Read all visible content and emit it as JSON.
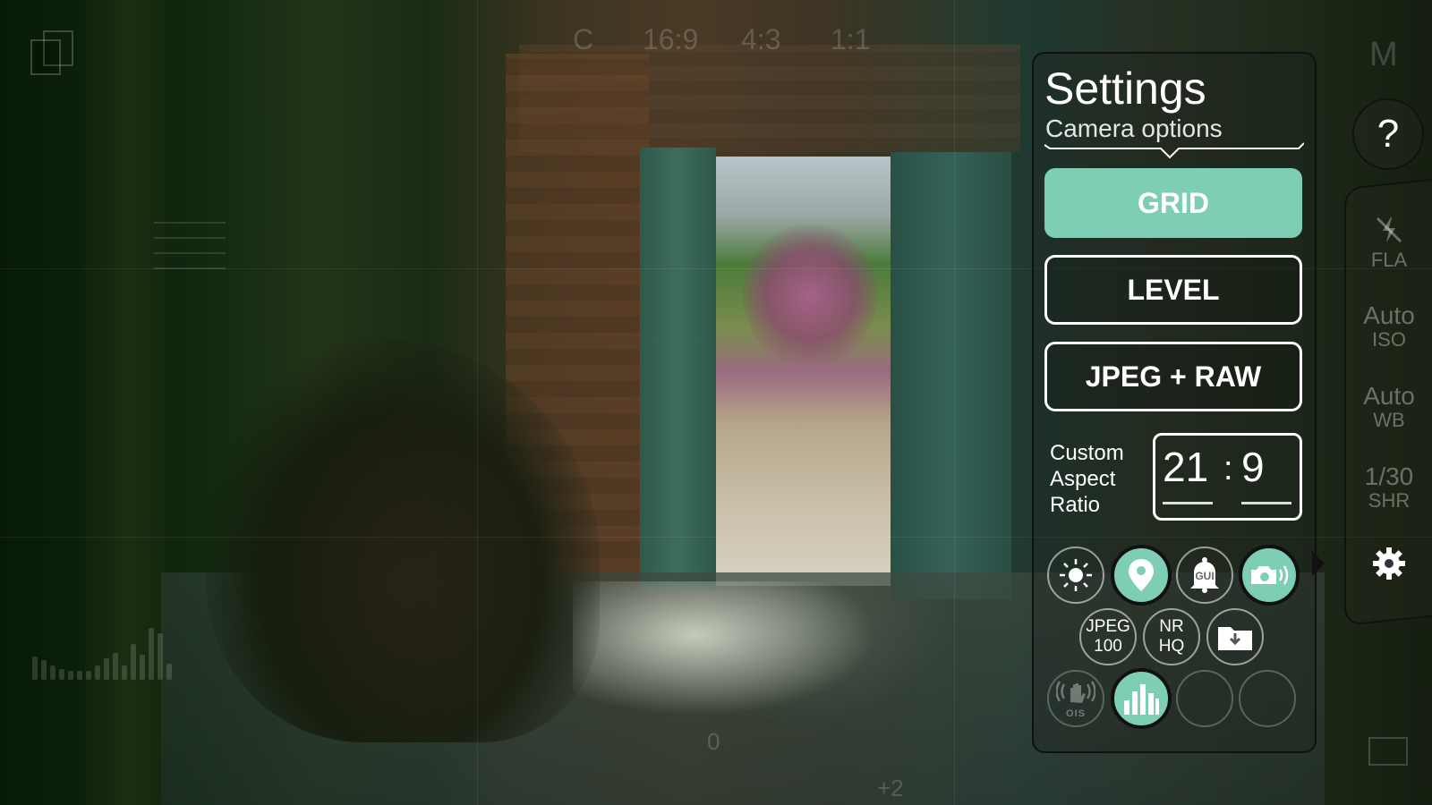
{
  "viewfinder": {
    "aspect_ratios": [
      "C",
      "16:9",
      "4:3",
      "1:1"
    ],
    "mode_label": "M",
    "exposure_marks": [
      "0",
      "+2"
    ]
  },
  "settings_panel": {
    "title": "Settings",
    "subtitle": "Camera options",
    "toggles": [
      {
        "label": "GRID",
        "active": true
      },
      {
        "label": "LEVEL",
        "active": false
      },
      {
        "label": "JPEG + RAW",
        "active": false
      }
    ],
    "custom_aspect_ratio": {
      "label_lines": [
        "Custom",
        "Aspect",
        "Ratio"
      ],
      "width": "21",
      "separator": ":",
      "height": "9"
    },
    "icon_buttons_row1": [
      {
        "name": "brightness",
        "icon": "sun-icon",
        "active": false
      },
      {
        "name": "location",
        "icon": "location-pin-icon",
        "active": true
      },
      {
        "name": "gui-sound",
        "icon": "bell-gui-icon",
        "label": "GUI",
        "active": false
      },
      {
        "name": "shutter-sound",
        "icon": "camera-sound-icon",
        "active": true
      }
    ],
    "icon_buttons_row2": [
      {
        "name": "jpeg-quality",
        "line1": "JPEG",
        "line2": "100",
        "active": false
      },
      {
        "name": "noise-reduction",
        "line1": "NR",
        "line2": "HQ",
        "active": false
      },
      {
        "name": "save-location",
        "icon": "folder-download-icon",
        "active": false
      }
    ],
    "icon_buttons_row3": [
      {
        "name": "ois",
        "icon": "hand-stabilize-icon",
        "label": "OIS",
        "active": false,
        "disabled": true
      },
      {
        "name": "histogram",
        "icon": "histogram-icon",
        "active": true
      },
      {
        "name": "empty-slot-1",
        "active": false,
        "disabled": true
      },
      {
        "name": "empty-slot-2",
        "active": false,
        "disabled": true
      }
    ]
  },
  "right_rail": {
    "help_label": "?",
    "items": [
      {
        "value": "",
        "key": "FLA"
      },
      {
        "value": "Auto",
        "key": "ISO"
      },
      {
        "value": "Auto",
        "key": "WB"
      },
      {
        "value": "1/30",
        "key": "SHR"
      }
    ]
  },
  "colors": {
    "accent": "#7dceb4",
    "panel_border": "#111111",
    "text": "#ffffff"
  }
}
